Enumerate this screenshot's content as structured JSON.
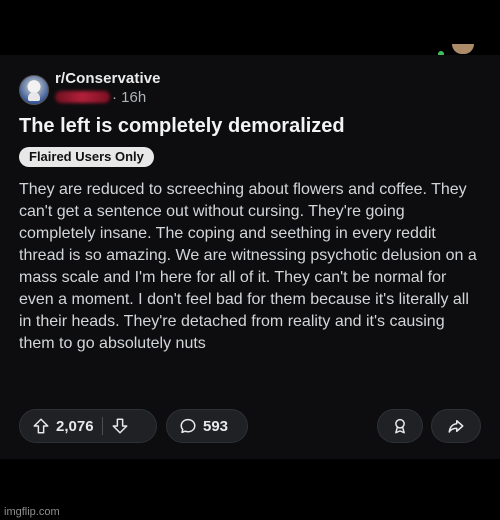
{
  "post": {
    "subreddit": "r/Conservative",
    "age": "· 16h",
    "title": "The left is completely demoralized",
    "flair": "Flaired Users Only",
    "body": "They are reduced to screeching about flowers and coffee. They can't get a sentence out without cursing. They're going completely insane. The coping and seething in every reddit thread is so amazing. We are witnessing psychotic delusion on a mass scale and I'm here for all of it. They can't be normal for even a moment. I don't feel bad for them because it's literally all in their heads. They're detached from reality and it's causing them to go absolutely nuts"
  },
  "actions": {
    "upvotes": "2,076",
    "comments": "593"
  },
  "icons": {
    "upvote": "upvote-arrow-icon",
    "downvote": "downvote-arrow-icon",
    "comment": "comment-bubble-icon",
    "award": "award-icon",
    "share": "share-arrow-icon"
  },
  "watermark": "imgflip.com",
  "colors": {
    "background": "#000000",
    "card": "#0d0d0f",
    "text": "#d3d6d8",
    "pill": "#1f2124",
    "flair_bg": "#e8e8e8"
  }
}
